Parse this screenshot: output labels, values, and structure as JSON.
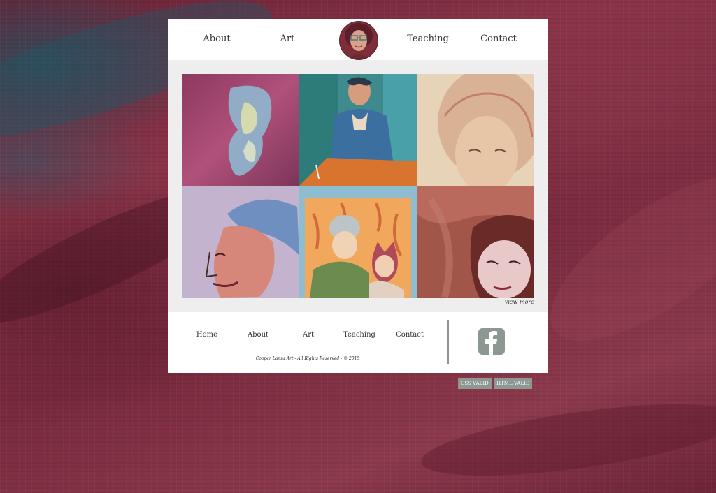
{
  "header": {
    "nav": [
      "About",
      "Art",
      "Teaching",
      "Contact"
    ]
  },
  "gallery": {
    "view_more": "view more"
  },
  "footer": {
    "nav": [
      "Home",
      "About",
      "Art",
      "Teaching",
      "Contact"
    ],
    "copyright": "Cooper Lanza Art - All Rights Reserved - © 2015"
  },
  "badges": {
    "css": "CSS VALID",
    "html": "HTML VALID"
  },
  "colors": {
    "background": "#7a2a3e",
    "accent_gray": "#8d9893"
  },
  "icons": {
    "social": "facebook-icon"
  }
}
